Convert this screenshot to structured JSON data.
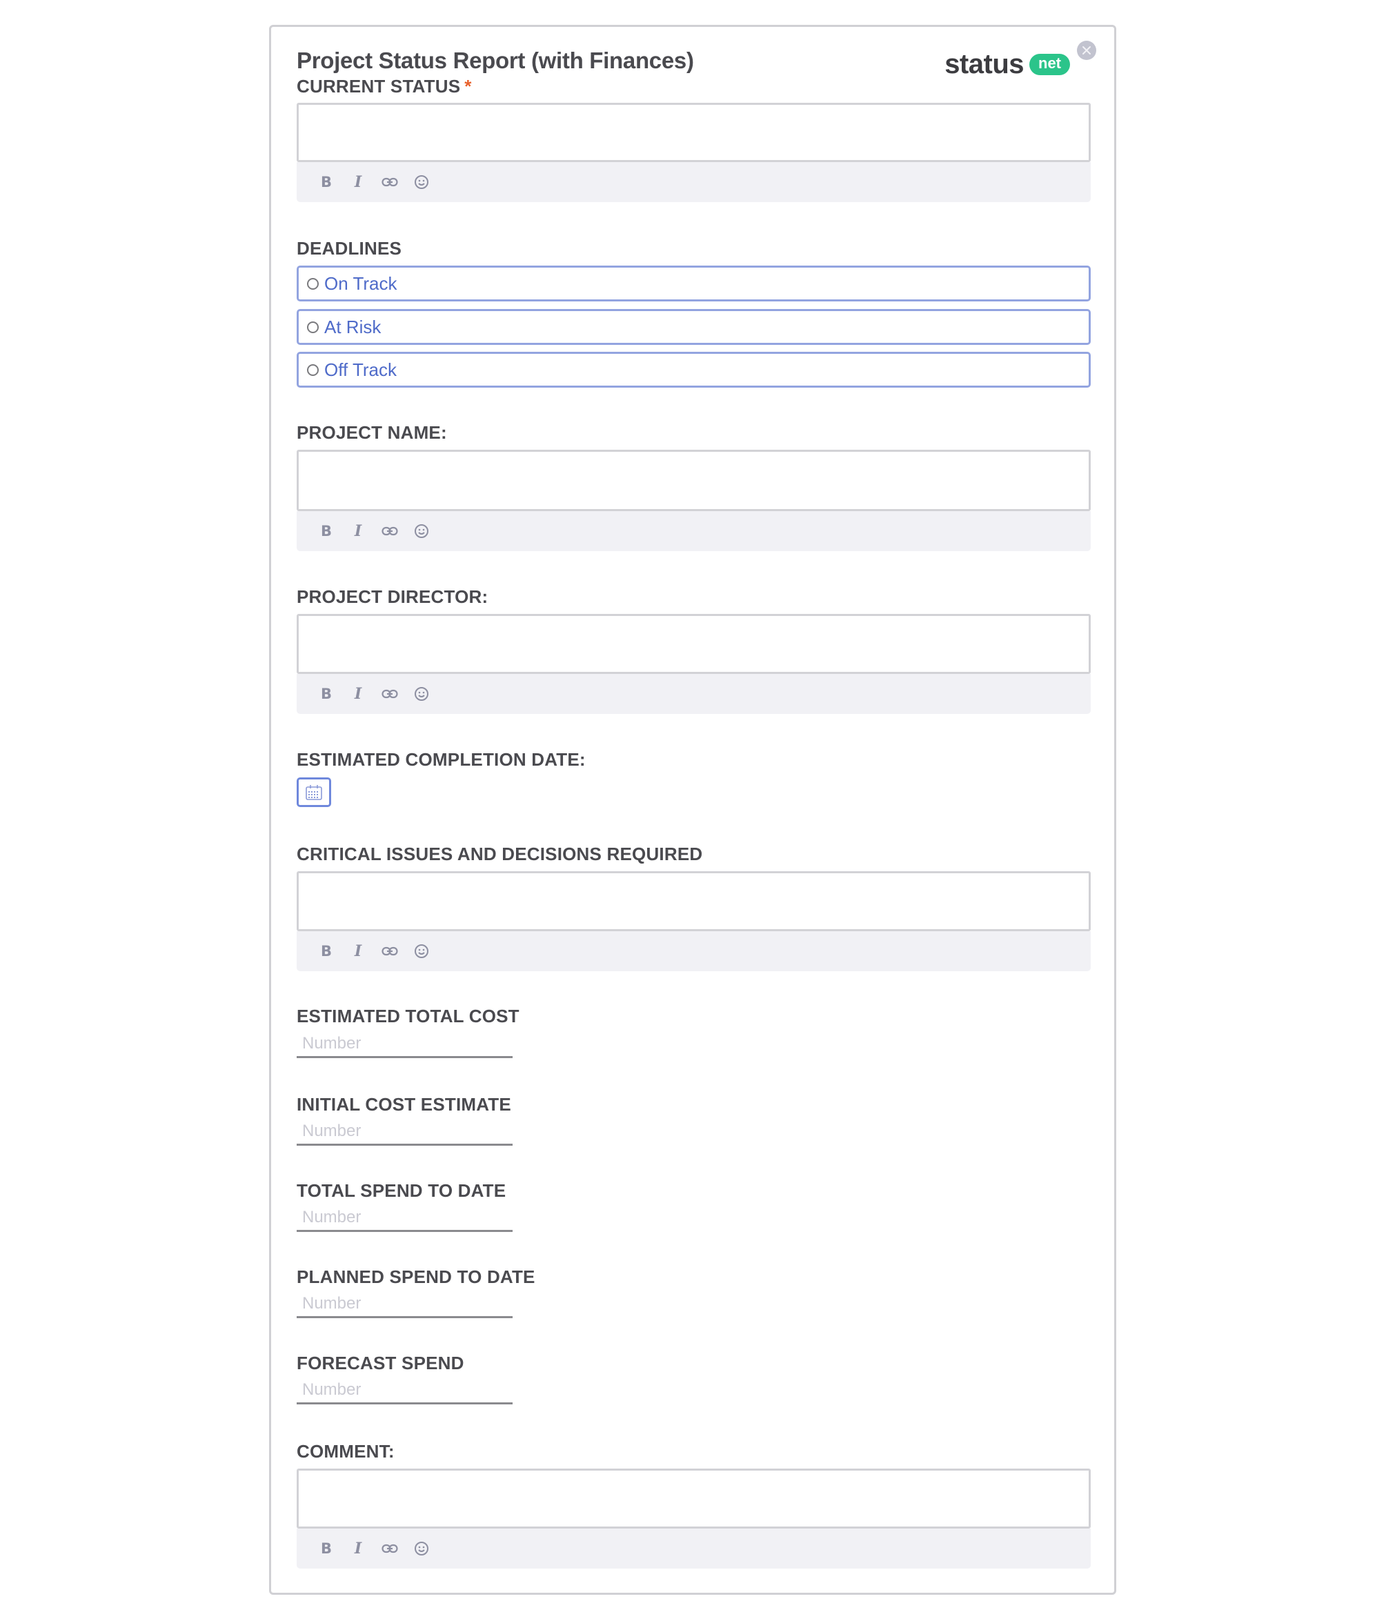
{
  "form": {
    "title": "Project Status Report (with Finances)",
    "close_icon": "close-icon",
    "brand": {
      "word": "status",
      "badge": "net",
      "badge_color": "#2bc48a"
    },
    "required_marker": "*",
    "accent_color": "#4f6bc9"
  },
  "toolbar": {
    "bold": "B",
    "italic": "I",
    "icons": [
      "bold-icon",
      "italic-icon",
      "link-icon",
      "emoji-icon"
    ]
  },
  "fields": {
    "current_status": {
      "label": "CURRENT STATUS",
      "required": true,
      "value": ""
    },
    "deadlines": {
      "label": "DEADLINES",
      "options": [
        {
          "label": "On Track",
          "selected": false
        },
        {
          "label": "At Risk",
          "selected": false
        },
        {
          "label": "Off Track",
          "selected": false
        }
      ]
    },
    "project_name": {
      "label": "PROJECT NAME:",
      "value": ""
    },
    "project_director": {
      "label": "PROJECT DIRECTOR:",
      "value": ""
    },
    "estimated_completion_date": {
      "label": "ESTIMATED COMPLETION DATE:",
      "icon": "calendar-icon",
      "value": ""
    },
    "critical_issues": {
      "label": "CRITICAL ISSUES AND DECISIONS REQUIRED",
      "value": ""
    },
    "estimated_total_cost": {
      "label": "ESTIMATED TOTAL COST",
      "placeholder": "Number",
      "value": ""
    },
    "initial_cost_estimate": {
      "label": "INITIAL COST ESTIMATE",
      "placeholder": "Number",
      "value": ""
    },
    "total_spend_to_date": {
      "label": "TOTAL SPEND TO DATE",
      "placeholder": "Number",
      "value": ""
    },
    "planned_spend_to_date": {
      "label": "PLANNED SPEND TO DATE",
      "placeholder": "Number",
      "value": ""
    },
    "forecast_spend": {
      "label": "FORECAST SPEND",
      "placeholder": "Number",
      "value": ""
    },
    "comment": {
      "label": "COMMENT:",
      "value": ""
    }
  }
}
